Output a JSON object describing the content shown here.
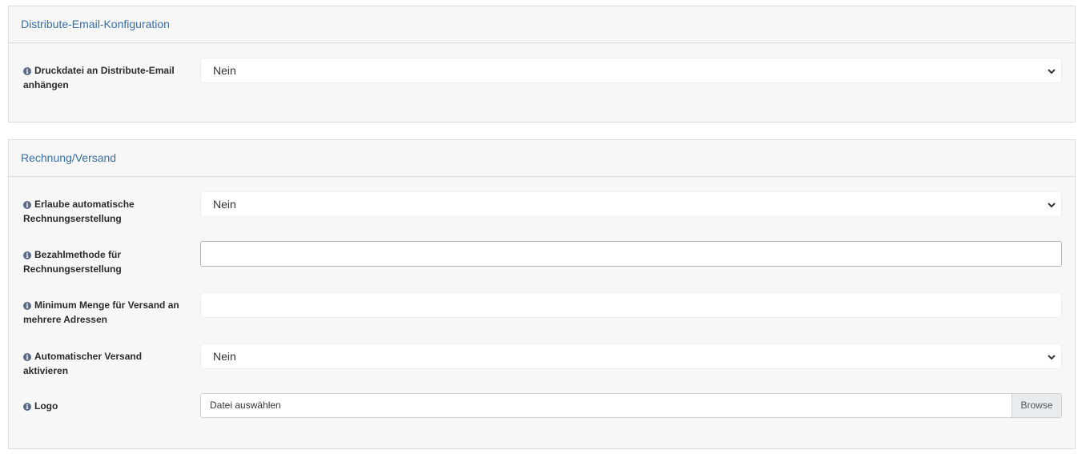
{
  "section1": {
    "title": "Distribute-Email-Konfiguration",
    "fields": {
      "druckdatei": {
        "label": "Druckdatei an Distribute-Email anhängen",
        "value": "Nein"
      }
    }
  },
  "section2": {
    "title": "Rechnung/Versand",
    "fields": {
      "rechnung": {
        "label": "Erlaube automatische Rechnungserstellung",
        "value": "Nein"
      },
      "bezahlmethode": {
        "label": "Bezahlmethode für Rechnungserstellung",
        "value": ""
      },
      "minimum": {
        "label": "Minimum Menge für Versand an mehrere Adressen",
        "value": ""
      },
      "versand": {
        "label": "Automatischer Versand aktivieren",
        "value": "Nein"
      },
      "logo": {
        "label": "Logo",
        "placeholder": "Datei auswählen",
        "button": "Browse"
      }
    }
  },
  "icons": {
    "info": "info-circle-icon",
    "dropdown": "chevron-down-icon"
  },
  "colors": {
    "section_title": "#3a6ea5",
    "panel_bg": "#f7f7f7",
    "info_icon": "#5b6b86"
  }
}
